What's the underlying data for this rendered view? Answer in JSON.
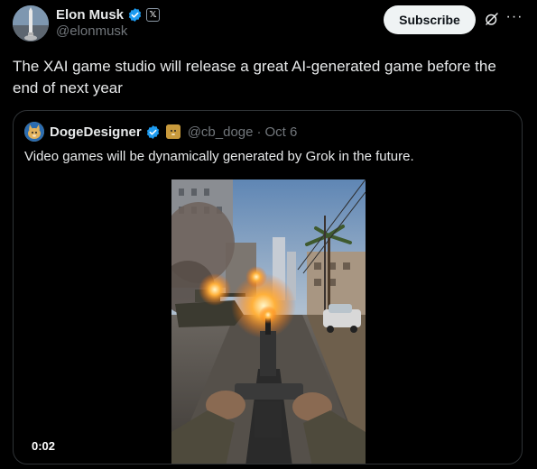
{
  "author": {
    "display_name": "Elon Musk",
    "handle": "@elonmusk",
    "verified_icon": "verified-badge-icon",
    "affiliation_icon": "x-logo-icon",
    "affiliation_label": "𝕏"
  },
  "actions": {
    "subscribe_label": "Subscribe",
    "grok_icon": "grok-icon",
    "more_icon": "more-icon",
    "more_label": "···"
  },
  "tweet": {
    "text": "The XAI game studio will release a great AI-generated game before the end of next year"
  },
  "quote": {
    "display_name": "DogeDesigner",
    "handle": "@cb_doge",
    "separator": "·",
    "date": "Oct 6",
    "text": "Video games will be dynamically generated by Grok in the future.",
    "video": {
      "timestamp": "0:02"
    }
  },
  "colors": {
    "background": "#000000",
    "text_primary": "#e7e9ea",
    "text_secondary": "#71767b",
    "verified_blue": "#1d9bf0",
    "border": "#2f3336",
    "subscribe_bg": "#eff3f4"
  }
}
